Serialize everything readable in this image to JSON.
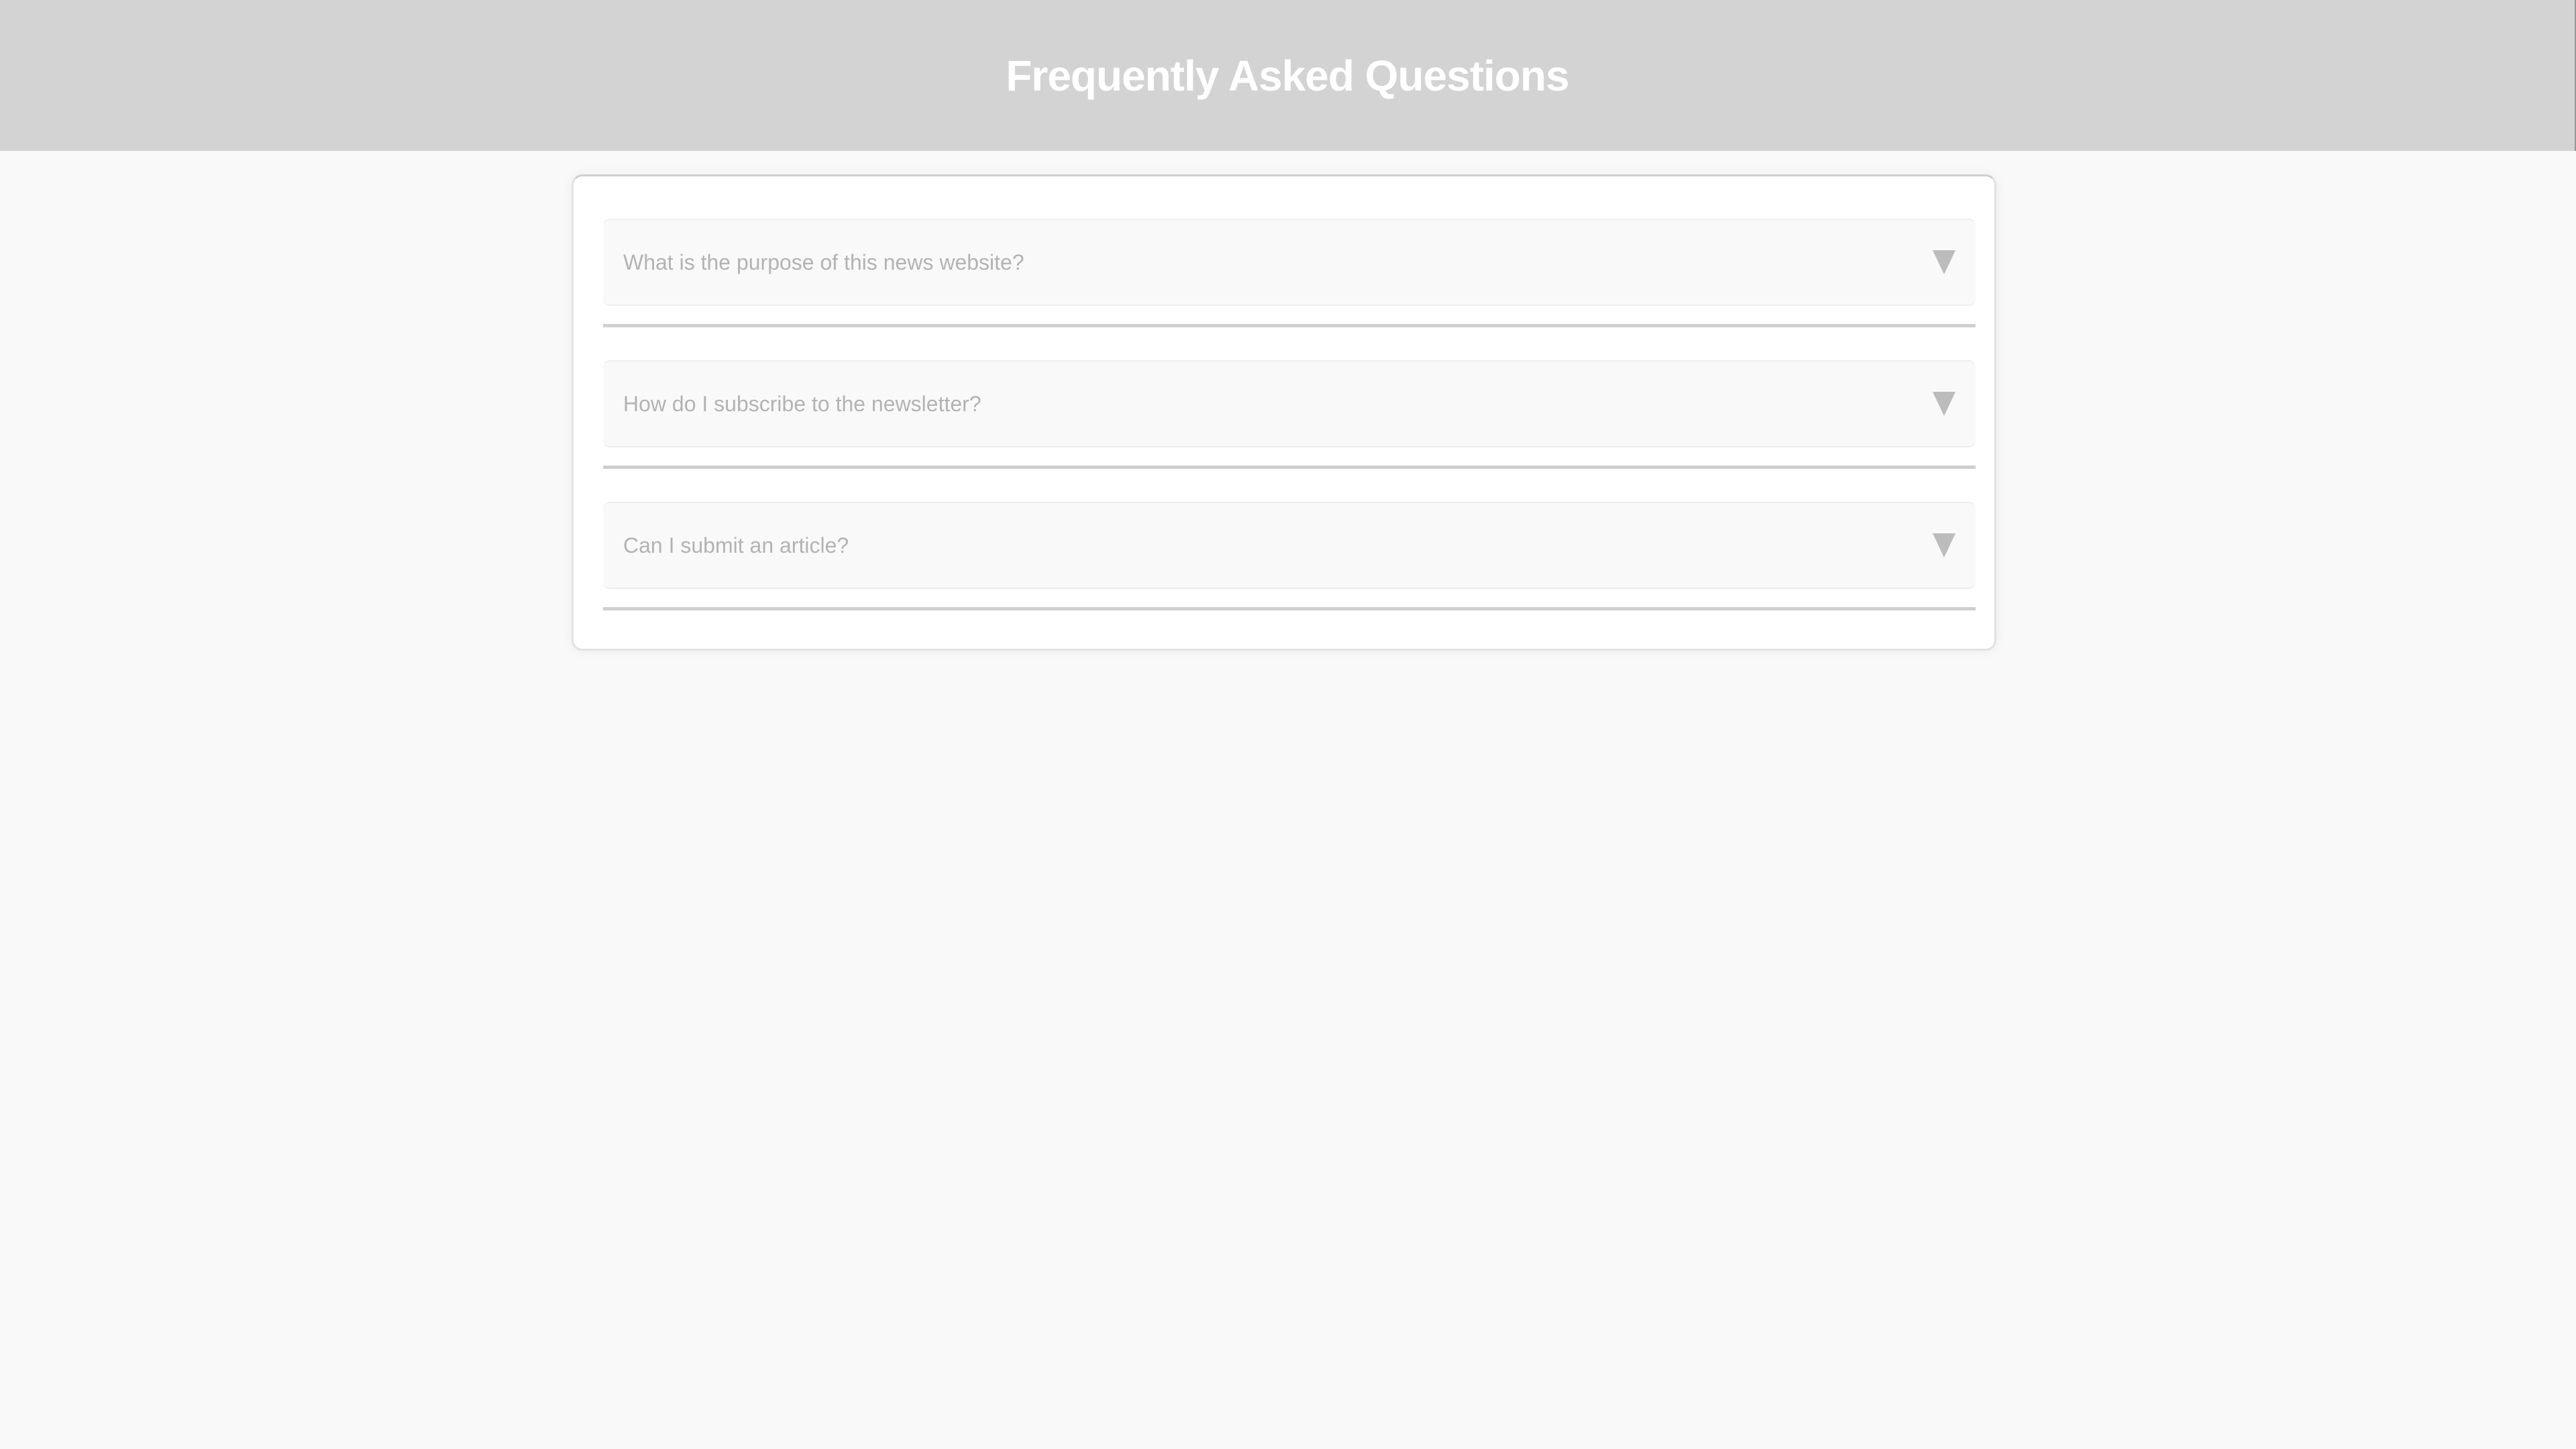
{
  "header": {
    "title": "Frequently Asked Questions"
  },
  "faq": [
    {
      "question": "What is the purpose of this news website?",
      "icon": "caret-down-icon"
    },
    {
      "question": "How do I subscribe to the newsletter?",
      "icon": "caret-down-icon"
    },
    {
      "question": "Can I submit an article?",
      "icon": "caret-down-icon"
    }
  ]
}
